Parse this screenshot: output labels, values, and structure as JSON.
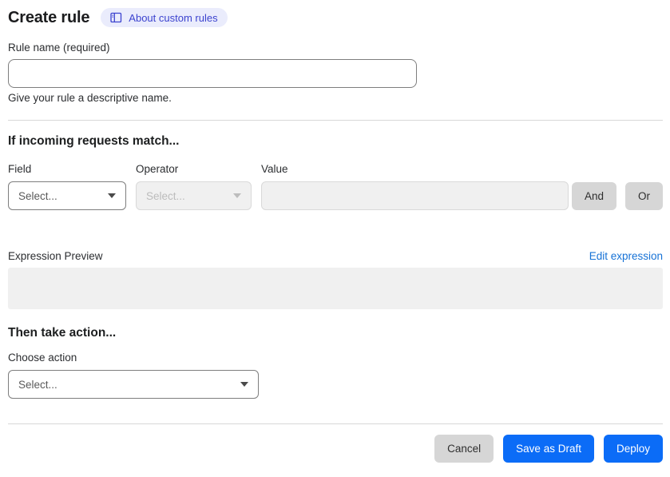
{
  "header": {
    "title": "Create rule",
    "about_link_label": "About custom rules"
  },
  "rule_name": {
    "label": "Rule name (required)",
    "value": "",
    "help": "Give your rule a descriptive name."
  },
  "match_section": {
    "heading": "If incoming requests match...",
    "field": {
      "label": "Field",
      "selected": "Select...",
      "enabled": true
    },
    "operator": {
      "label": "Operator",
      "selected": "Select...",
      "enabled": false
    },
    "value": {
      "label": "Value",
      "value": "",
      "enabled": false
    },
    "and_button_label": "And",
    "or_button_label": "Or"
  },
  "expression": {
    "label": "Expression Preview",
    "edit_link_label": "Edit expression",
    "content": ""
  },
  "action_section": {
    "heading": "Then take action...",
    "choose_label": "Choose action",
    "selected": "Select..."
  },
  "footer": {
    "cancel_label": "Cancel",
    "save_draft_label": "Save as Draft",
    "deploy_label": "Deploy"
  },
  "icons": {
    "about": "book-icon",
    "dropdown": "chevron-down-icon"
  },
  "colors": {
    "primary_button_blue": "#0b6cf7",
    "link_blue": "#1672d6",
    "badge_background": "#eaecfc",
    "badge_text": "#3c43cf",
    "disabled_background": "#f0f0f0",
    "gray_button": "#d6d6d6",
    "divider": "#d8d8d8"
  }
}
